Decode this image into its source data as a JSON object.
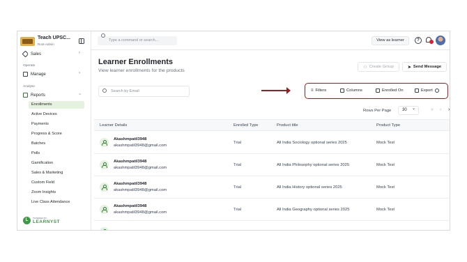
{
  "brand": {
    "title": "Teach UPSC...",
    "subtitle": "Root-Admin",
    "footer_prefix": "POWERED BY",
    "footer": "LEARNYST"
  },
  "sidebar": {
    "top_item": "Sales",
    "section_operate": "Operate",
    "manage": "Manage",
    "section_analyse": "Analyse",
    "reports": "Reports",
    "items": [
      "Enrollments",
      "Active Devices",
      "Payments",
      "Progress & Score",
      "Batches",
      "Polls",
      "Gamification",
      "Sales & Marketing",
      "Custom Field",
      "Zoom Insights",
      "Live Class Attendance"
    ],
    "active_index": 0
  },
  "topbar": {
    "command_placeholder": "Type a command or search...",
    "view_as_learner": "View as learner",
    "help_glyph": "?"
  },
  "page": {
    "title": "Learner Enrollments",
    "subtitle": "View learner enrollments for the products"
  },
  "actions": {
    "create_group": "Create Group",
    "send_message": "Send Message"
  },
  "search": {
    "placeholder": "Search by Email"
  },
  "toolbar": {
    "filters": "Filters",
    "columns": "Columns",
    "enrolled_on": "Enrolled On",
    "export": "Export"
  },
  "pagination": {
    "rows_per_page_label": "Rows Per Page",
    "rows_per_page": "30"
  },
  "table": {
    "headers": [
      "Learner Details",
      "Enrolled Type",
      "Product title",
      "Product Type"
    ],
    "rows": [
      {
        "name": "Akashmpatil3948",
        "email": "akashmpatil3948@gmail.com",
        "type": "Trial",
        "product": "All India Sociology optional series 2025",
        "product_type": "Mock Test"
      },
      {
        "name": "Akashmpatil3948",
        "email": "akashmpatil3948@gmail.com",
        "type": "Trial",
        "product": "All India Philosophy optional series 2025",
        "product_type": "Mock Test"
      },
      {
        "name": "Akashmpatil3948",
        "email": "akashmpatil3948@gmail.com",
        "type": "Trial",
        "product": "All India History optional series 2025",
        "product_type": "Mock Test"
      },
      {
        "name": "Akashmpatil3948",
        "email": "akashmpatil3948@gmail.com",
        "type": "Trial",
        "product": "All India Geography optional series 2025",
        "product_type": "Mock Test"
      }
    ]
  },
  "colors": {
    "accent_green": "#3f9a46",
    "highlight_red": "#a11d1d",
    "notification": "#e11d2e"
  },
  "icons": {
    "panel": "sidebar-toggle-icon",
    "help": "help-icon",
    "bell": "bell-icon",
    "send": "send-icon"
  }
}
